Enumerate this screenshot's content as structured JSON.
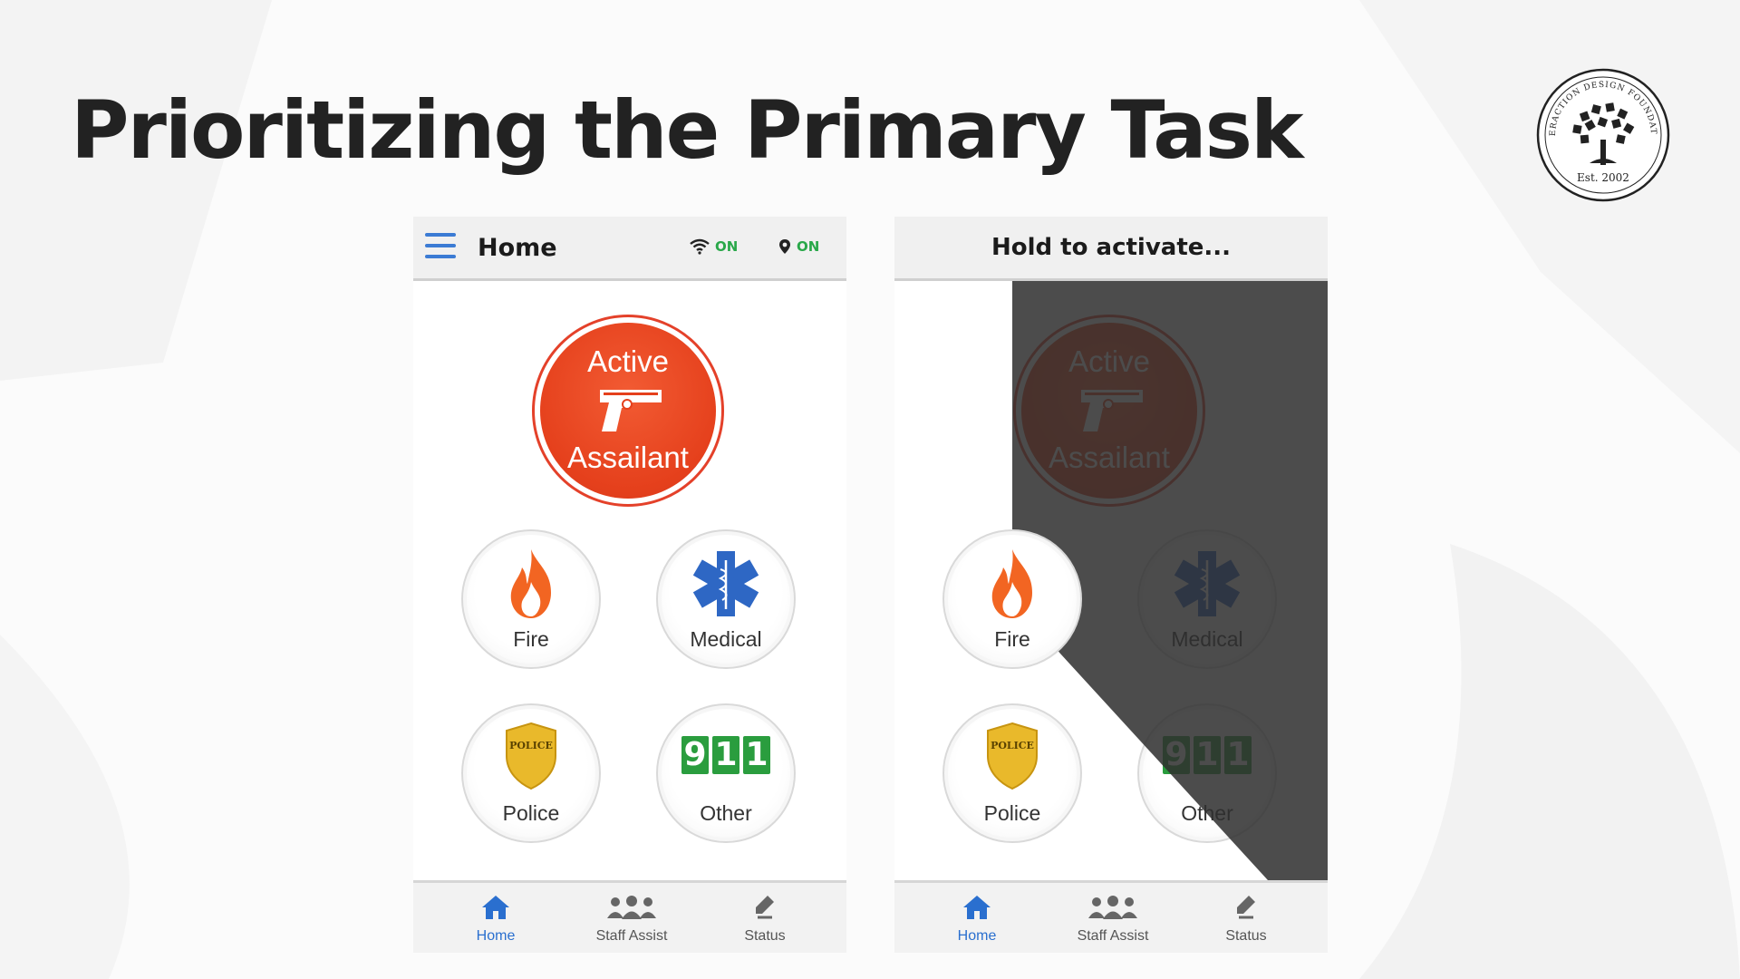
{
  "slide": {
    "title": "Prioritizing the Primary Task"
  },
  "logo": {
    "ring_text": "INTERACTION DESIGN FOUNDATION",
    "est": "Est. 2002"
  },
  "left_phone": {
    "topbar": {
      "menu_icon": "hamburger-menu-icon",
      "title": "Home",
      "wifi_icon": "wifi-icon",
      "wifi_status": "ON",
      "location_icon": "location-pin-icon",
      "location_status": "ON"
    },
    "primary_button": {
      "line1": "Active",
      "line2": "Assailant",
      "icon": "handgun-icon"
    },
    "buttons": [
      {
        "label": "Fire",
        "icon": "flame-icon"
      },
      {
        "label": "Medical",
        "icon": "star-of-life-icon"
      },
      {
        "label": "Police",
        "icon": "police-badge-icon",
        "badge_text": "POLICE"
      },
      {
        "label": "Other",
        "icon": "911-icon",
        "digits": [
          "9",
          "1",
          "1"
        ]
      }
    ],
    "tabs": [
      {
        "label": "Home",
        "icon": "home-icon"
      },
      {
        "label": "Staff Assist",
        "icon": "staff-group-icon"
      },
      {
        "label": "Status",
        "icon": "status-edit-icon"
      }
    ]
  },
  "right_phone": {
    "topbar": {
      "title": "Hold to activate..."
    },
    "primary_button": {
      "line1": "Active",
      "line2": "Assailant",
      "icon": "handgun-icon"
    },
    "buttons": [
      {
        "label": "Fire",
        "icon": "flame-icon"
      },
      {
        "label": "Medical",
        "icon": "star-of-life-icon"
      },
      {
        "label": "Police",
        "icon": "police-badge-icon",
        "badge_text": "POLICE"
      },
      {
        "label": "Other",
        "icon": "911-icon",
        "digits": [
          "9",
          "1",
          "1"
        ]
      }
    ],
    "tabs": [
      {
        "label": "Home",
        "icon": "home-icon"
      },
      {
        "label": "Staff Assist",
        "icon": "staff-group-icon"
      },
      {
        "label": "Status",
        "icon": "status-edit-icon"
      }
    ]
  },
  "colors": {
    "primary_red": "#e5401c",
    "accent_blue": "#2a6fcf",
    "status_green": "#2aa84a",
    "overlay_dark": "#3a3a3a"
  }
}
